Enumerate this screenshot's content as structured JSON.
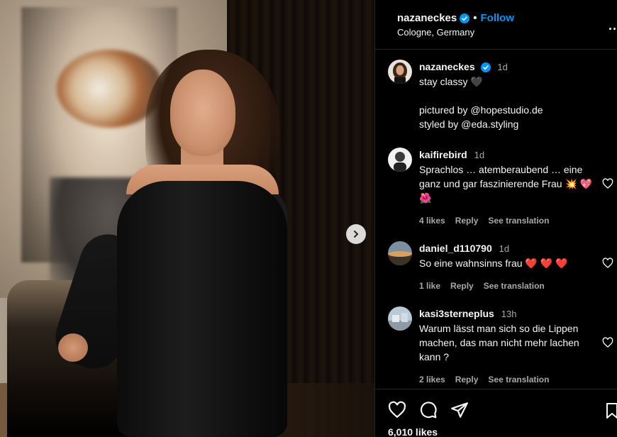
{
  "post": {
    "username": "nazaneckes",
    "location": "Cologne, Germany",
    "follow_label": "Follow",
    "separator": "•",
    "more_label": "...",
    "caption": {
      "username": "nazaneckes",
      "time": "1d",
      "line1": "stay classy 🖤",
      "line2": "pictured by @hopestudio.de",
      "line3": "styled by @eda.styling"
    },
    "likes": "6,010 likes"
  },
  "comments": [
    {
      "username": "kaifirebird",
      "time": "1d",
      "text": "Sprachlos … atemberaubend … eine ganz und gar faszinierende Frau 💥 💖 🌺",
      "likes": "4 likes",
      "reply": "Reply",
      "translate": "See translation"
    },
    {
      "username": "daniel_d110790",
      "time": "1d",
      "text": "So eine wahnsinns frau ❤️ ❤️ ❤️",
      "likes": "1 like",
      "reply": "Reply",
      "translate": "See translation"
    },
    {
      "username": "kasi3sterneplus",
      "time": "13h",
      "text": "Warum lässt man sich so die Lippen machen, das man nicht mehr lachen kann ?",
      "likes": "2 likes",
      "reply": "Reply",
      "translate": "See translation"
    }
  ],
  "colors": {
    "accent": "#0095f6",
    "muted": "#a8a8a8",
    "divider": "#262626"
  }
}
